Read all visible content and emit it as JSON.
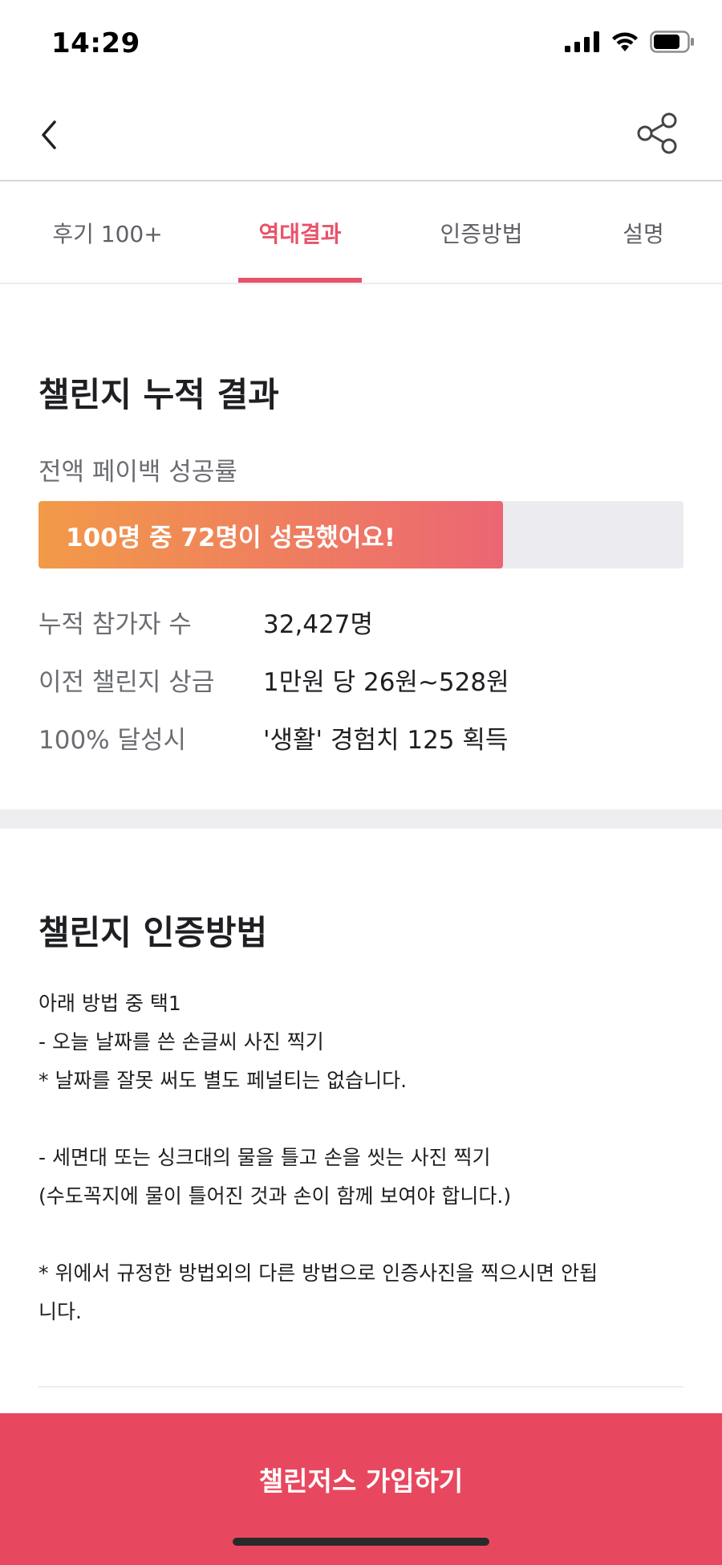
{
  "status_bar": {
    "time": "14:29"
  },
  "tabs": [
    {
      "label": "후기 100+"
    },
    {
      "label": "역대결과"
    },
    {
      "label": "인증방법"
    },
    {
      "label": "설명"
    }
  ],
  "results": {
    "title": "챌린지 누적 결과",
    "subtitle": "전액 페이백 성공률",
    "progress_text": "100명 중 72명이 성공했어요!",
    "progress_fraction": 0.72,
    "stats": [
      {
        "label": "누적 참가자 수",
        "value": "32,427명"
      },
      {
        "label": "이전 챌린지 상금",
        "value": "1만원 당 26원~528원"
      },
      {
        "label": "100% 달성시",
        "value": "'생활' 경험치 125 획득"
      }
    ]
  },
  "method": {
    "title": "챌린지 인증방법",
    "lines": [
      "아래 방법 중 택1",
      "- 오늘 날짜를 쓴 손글씨 사진 찍기",
      "* 날짜를 잘못 써도 별도 페널티는 없습니다.",
      "",
      "- 세면대 또는 싱크대의 물을 틀고 손을 씻는 사진 찍기",
      "(수도꼭지에 물이 틀어진 것과 손이 함께 보여야 합니다.)",
      "",
      "* 위에서 규정한 방법외의 다른 방법으로 인증사진을 찍으시면 안됩",
      "니다."
    ]
  },
  "cta": {
    "label": "챌린저스 가입하기"
  },
  "colors": {
    "accent": "#e8536a",
    "cta": "#e8485f",
    "gradient_start": "#f29a48",
    "gradient_end": "#ec6673"
  }
}
